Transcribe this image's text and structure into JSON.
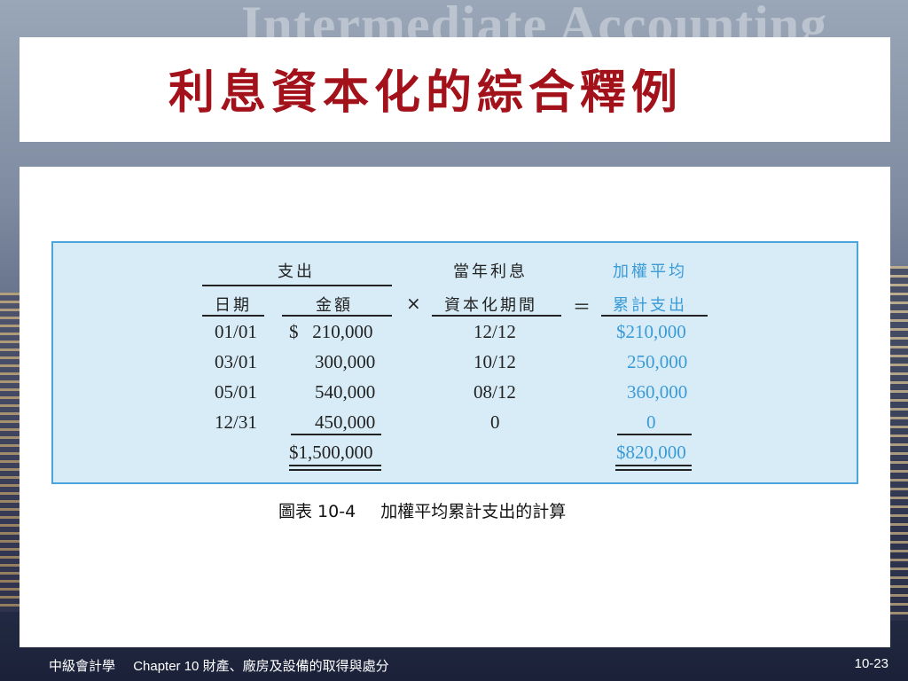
{
  "watermark": "Intermediate Accounting",
  "title": "利息資本化的綜合釋例",
  "table": {
    "group_header_expenditure": "支出",
    "col_date": "日期",
    "col_amount": "金額",
    "times": "×",
    "col_fraction_top": "當年利息",
    "col_fraction_bottom": "資本化期間",
    "equals": "＝",
    "col_weighted_top": "加權平均",
    "col_weighted_bottom": "累計支出",
    "rows": [
      {
        "date": "01/01",
        "amount": "$   210,000",
        "fraction": "12/12",
        "weighted": "$210,000"
      },
      {
        "date": "03/01",
        "amount": "300,000",
        "fraction": "10/12",
        "weighted": "250,000"
      },
      {
        "date": "05/01",
        "amount": "540,000",
        "fraction": "08/12",
        "weighted": "360,000"
      },
      {
        "date": "12/31",
        "amount": "450,000",
        "fraction": "0",
        "weighted": "0"
      }
    ],
    "total_amount": "$1,500,000",
    "total_weighted": "$820,000"
  },
  "caption": {
    "figure_no": "圖表 10-4",
    "text": "加權平均累計支出的計算"
  },
  "footer": {
    "course": "中級會計學",
    "chapter": "Chapter 10 財產、廠房及設備的取得與處分",
    "page": "10-23"
  },
  "colors": {
    "title": "#a3111a",
    "accent_blue": "#3a9bd6",
    "figure_bg": "#d8ecf7",
    "figure_border": "#4aa5dc"
  }
}
